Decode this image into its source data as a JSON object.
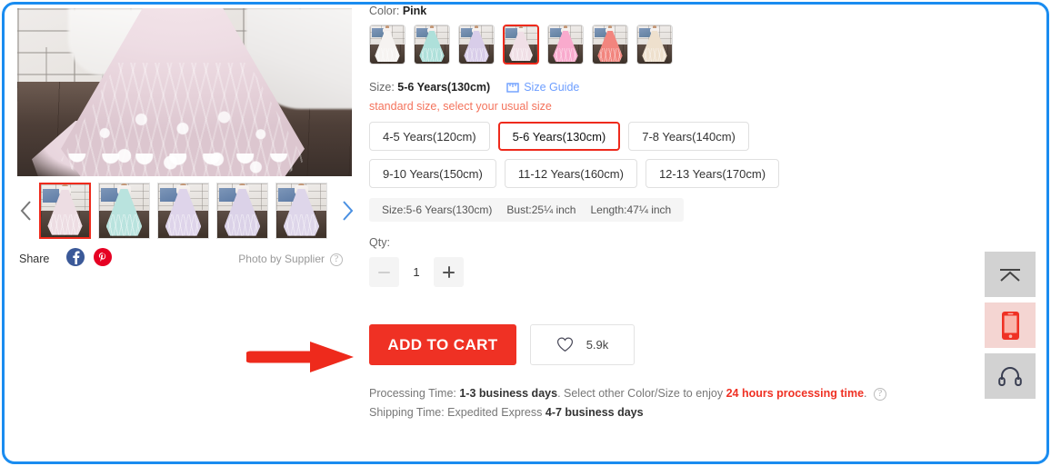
{
  "frame": {
    "border_color": "#1a8cf0"
  },
  "gallery": {
    "main_image_alt": "pink lace ball gown skirt on dark wood floor",
    "prev_arrow": "chevron-left",
    "next_arrow": "chevron-right",
    "thumbnails": [
      {
        "name": "pink lace gown",
        "dress_color": "#eddde3",
        "selected": true
      },
      {
        "name": "mint lace gown",
        "dress_color": "#b9e3de",
        "selected": false
      },
      {
        "name": "lavender lace gown",
        "dress_color": "#ded4ea",
        "selected": false
      },
      {
        "name": "lilac lace gown",
        "dress_color": "#dbd2e8",
        "selected": false
      },
      {
        "name": "lilac gown model",
        "dress_color": "#ded6ea",
        "selected": false
      }
    ],
    "share_label": "Share",
    "social": [
      {
        "name": "facebook",
        "glyph": "f",
        "color": "#3b5998"
      },
      {
        "name": "pinterest",
        "glyph": "P",
        "color": "#e60023"
      }
    ],
    "photo_by": "Photo by Supplier",
    "photo_by_help": "?"
  },
  "color": {
    "label": "Color:",
    "value": "Pink",
    "swatches": [
      {
        "name": "White",
        "dress_color": "#f6f3f1",
        "selected": false
      },
      {
        "name": "Mint",
        "dress_color": "#aee0da",
        "selected": false
      },
      {
        "name": "Lavender",
        "dress_color": "#d8cde9",
        "selected": false
      },
      {
        "name": "Pink",
        "dress_color": "#f0dfe6",
        "selected": true
      },
      {
        "name": "Hot Pink",
        "dress_color": "#f9aacd",
        "selected": false
      },
      {
        "name": "Coral",
        "dress_color": "#f2857e",
        "selected": false
      },
      {
        "name": "Champagne",
        "dress_color": "#eee0cd",
        "selected": false
      }
    ]
  },
  "size": {
    "label": "Size:",
    "value": "5-6 Years(130cm)",
    "guide_label": "Size Guide",
    "guide_icon": "ruler-icon",
    "hint": "standard size, select your usual size",
    "options": [
      {
        "label": "4-5 Years(120cm)",
        "selected": false
      },
      {
        "label": "5-6 Years(130cm)",
        "selected": true
      },
      {
        "label": "7-8 Years(140cm)",
        "selected": false
      },
      {
        "label": "9-10 Years(150cm)",
        "selected": false
      },
      {
        "label": "11-12 Years(160cm)",
        "selected": false
      },
      {
        "label": "12-13 Years(170cm)",
        "selected": false
      }
    ],
    "measurements": [
      "Size:5-6 Years(130cm)",
      "Bust:25¼ inch",
      "Length:47¼ inch"
    ]
  },
  "qty": {
    "label": "Qty:",
    "value": "1",
    "minus_enabled": false,
    "plus_enabled": true
  },
  "actions": {
    "add_to_cart": "ADD TO CART",
    "favorites_count": "5.9k",
    "favorites_icon": "heart-icon",
    "accent_color": "#ef3124"
  },
  "shipping": {
    "processing_prefix": "Processing Time:",
    "processing_value": "1-3 business days",
    "processing_mid": ". Select other Color/Size to enjoy",
    "processing_highlight": "24 hours processing time",
    "processing_suffix": ".",
    "help": "?",
    "shipping_prefix": "Shipping Time: Expedited Express",
    "shipping_value": "4-7 business days"
  },
  "annotation": {
    "arrow": "red-right-arrow pointing at ADD TO CART",
    "color": "#ee2a1c"
  },
  "rail": [
    {
      "name": "scroll-to-top",
      "icon": "chevron-up-bar-icon",
      "highlight": false
    },
    {
      "name": "mobile-app",
      "icon": "mobile-phone-icon",
      "highlight": true
    },
    {
      "name": "customer-service",
      "icon": "headset-icon",
      "highlight": false
    }
  ]
}
